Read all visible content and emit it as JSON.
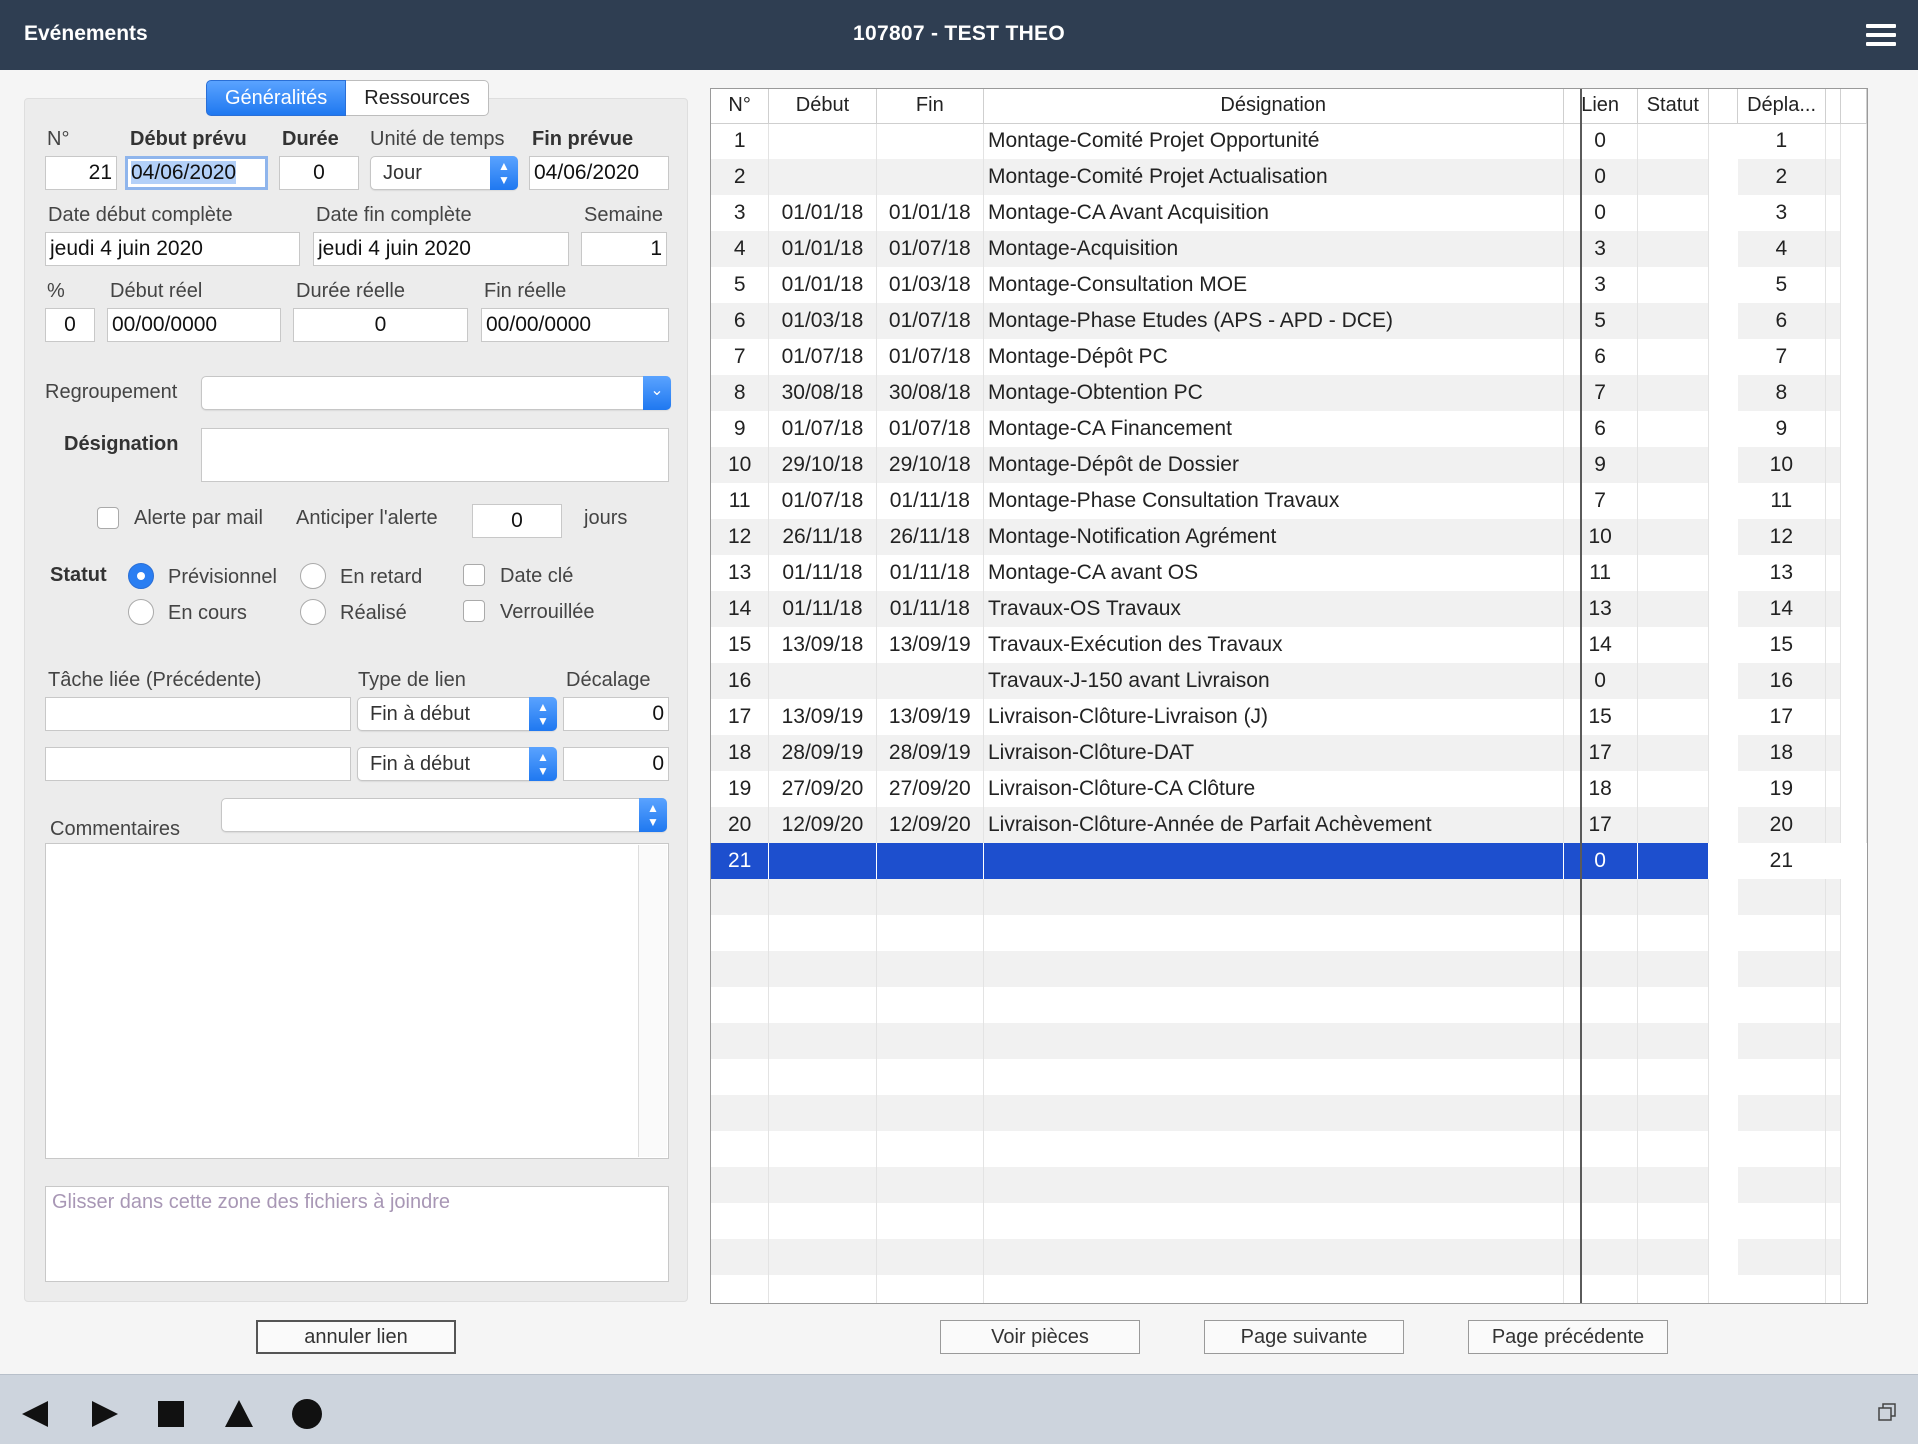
{
  "window": {
    "app_name": "Evénements",
    "title": "107807 - TEST THEO"
  },
  "tabs": [
    {
      "label": "Généralités",
      "active": true
    },
    {
      "label": "Ressources",
      "active": false
    }
  ],
  "form": {
    "no_label": "N°",
    "no_value": "21",
    "debut_prevu_label": "Début prévu",
    "debut_prevu_value": "04/06/2020",
    "duree_label": "Durée",
    "duree_value": "0",
    "unite_label": "Unité de temps",
    "unite_value": "Jour",
    "fin_prevue_label": "Fin prévue",
    "fin_prevue_value": "04/06/2020",
    "date_debut_complete_label": "Date début complète",
    "date_debut_complete_value": "jeudi 4 juin 2020",
    "date_fin_complete_label": "Date fin complète",
    "date_fin_complete_value": "jeudi 4 juin 2020",
    "semaine_label": "Semaine",
    "semaine_value": "1",
    "pct_label": "%",
    "pct_value": "0",
    "debut_reel_label": "Début réel",
    "debut_reel_value": "00/00/0000",
    "duree_reelle_label": "Durée réelle",
    "duree_reelle_value": "0",
    "fin_reelle_label": "Fin réelle",
    "fin_reelle_value": "00/00/0000",
    "regroupement_label": "Regroupement",
    "regroupement_value": "",
    "designation_label": "Désignation",
    "designation_value": "",
    "alerte_label": "Alerte par mail",
    "alerte_checked": false,
    "anticiper_label": "Anticiper l'alerte",
    "anticiper_value": "0",
    "jours_label": "jours",
    "statut_label": "Statut",
    "statut_options": {
      "previsionnel": "Prévisionnel",
      "en_retard": "En retard",
      "en_cours": "En cours",
      "realise": "Réalisé"
    },
    "statut_selected": "Prévisionnel",
    "date_cle_label": "Date clé",
    "verrouillee_label": "Verrouillée",
    "tache_liee_label": "Tâche liée (Précédente)",
    "type_lien_label": "Type de lien",
    "decalage_label": "Décalage",
    "links": [
      {
        "tache": "",
        "type": "Fin à début",
        "decalage": "0"
      },
      {
        "tache": "",
        "type": "Fin à début",
        "decalage": "0"
      }
    ],
    "commentaires_label": "Commentaires",
    "commentaires_value": "",
    "attach_placeholder": "Glisser dans cette zone des fichiers à joindre"
  },
  "buttons": {
    "annuler_lien": "annuler lien",
    "voir_pieces": "Voir pièces",
    "page_suivante": "Page suivante",
    "page_precedente": "Page précédente"
  },
  "table": {
    "headers": {
      "no": "N°",
      "debut": "Début",
      "fin": "Fin",
      "designation": "Désignation",
      "lien": "Lien",
      "statut": "Statut",
      "depla": "Dépla..."
    },
    "rows": [
      {
        "no": "1",
        "debut": "",
        "fin": "",
        "designation": "Montage-Comité Projet Opportunité",
        "lien": "0",
        "statut": "",
        "depla": "1"
      },
      {
        "no": "2",
        "debut": "",
        "fin": "",
        "designation": "Montage-Comité Projet Actualisation",
        "lien": "0",
        "statut": "",
        "depla": "2"
      },
      {
        "no": "3",
        "debut": "01/01/18",
        "fin": "01/01/18",
        "designation": "Montage-CA Avant Acquisition",
        "lien": "0",
        "statut": "",
        "depla": "3"
      },
      {
        "no": "4",
        "debut": "01/01/18",
        "fin": "01/07/18",
        "designation": "Montage-Acquisition",
        "lien": "3",
        "statut": "",
        "depla": "4"
      },
      {
        "no": "5",
        "debut": "01/01/18",
        "fin": "01/03/18",
        "designation": "Montage-Consultation MOE",
        "lien": "3",
        "statut": "",
        "depla": "5"
      },
      {
        "no": "6",
        "debut": "01/03/18",
        "fin": "01/07/18",
        "designation": "Montage-Phase Etudes (APS - APD - DCE)",
        "lien": "5",
        "statut": "",
        "depla": "6"
      },
      {
        "no": "7",
        "debut": "01/07/18",
        "fin": "01/07/18",
        "designation": "Montage-Dépôt PC",
        "lien": "6",
        "statut": "",
        "depla": "7"
      },
      {
        "no": "8",
        "debut": "30/08/18",
        "fin": "30/08/18",
        "designation": "Montage-Obtention PC",
        "lien": "7",
        "statut": "",
        "depla": "8"
      },
      {
        "no": "9",
        "debut": "01/07/18",
        "fin": "01/07/18",
        "designation": "Montage-CA Financement",
        "lien": "6",
        "statut": "",
        "depla": "9"
      },
      {
        "no": "10",
        "debut": "29/10/18",
        "fin": "29/10/18",
        "designation": "Montage-Dépôt de Dossier",
        "lien": "9",
        "statut": "",
        "depla": "10"
      },
      {
        "no": "11",
        "debut": "01/07/18",
        "fin": "01/11/18",
        "designation": "Montage-Phase Consultation Travaux",
        "lien": "7",
        "statut": "",
        "depla": "11"
      },
      {
        "no": "12",
        "debut": "26/11/18",
        "fin": "26/11/18",
        "designation": "Montage-Notification Agrément",
        "lien": "10",
        "statut": "",
        "depla": "12"
      },
      {
        "no": "13",
        "debut": "01/11/18",
        "fin": "01/11/18",
        "designation": "Montage-CA avant OS",
        "lien": "11",
        "statut": "",
        "depla": "13"
      },
      {
        "no": "14",
        "debut": "01/11/18",
        "fin": "01/11/18",
        "designation": "Travaux-OS Travaux",
        "lien": "13",
        "statut": "",
        "depla": "14"
      },
      {
        "no": "15",
        "debut": "13/09/18",
        "fin": "13/09/19",
        "designation": "Travaux-Exécution des Travaux",
        "lien": "14",
        "statut": "",
        "depla": "15"
      },
      {
        "no": "16",
        "debut": "",
        "fin": "",
        "designation": "Travaux-J-150 avant Livraison",
        "lien": "0",
        "statut": "",
        "depla": "16"
      },
      {
        "no": "17",
        "debut": "13/09/19",
        "fin": "13/09/19",
        "designation": "Livraison-Clôture-Livraison (J)",
        "lien": "15",
        "statut": "",
        "depla": "17"
      },
      {
        "no": "18",
        "debut": "28/09/19",
        "fin": "28/09/19",
        "designation": "Livraison-Clôture-DAT",
        "lien": "17",
        "statut": "",
        "depla": "18"
      },
      {
        "no": "19",
        "debut": "27/09/20",
        "fin": "27/09/20",
        "designation": "Livraison-Clôture-CA Clôture",
        "lien": "18",
        "statut": "",
        "depla": "19"
      },
      {
        "no": "20",
        "debut": "12/09/20",
        "fin": "12/09/20",
        "designation": "Livraison-Clôture-Année de Parfait Achèvement",
        "lien": "17",
        "statut": "",
        "depla": "20"
      },
      {
        "no": "21",
        "debut": "",
        "fin": "",
        "designation": "",
        "lien": "0",
        "statut": "",
        "depla": "21",
        "selected": true
      }
    ],
    "empty_rows": 12
  },
  "toolbar_icons": [
    "back-triangle-icon",
    "play-triangle-icon",
    "stop-square-icon",
    "up-triangle-icon",
    "record-circle-icon"
  ],
  "colors": {
    "titlebar": "#2f3e52",
    "accent": "#1f78f0",
    "selected_row": "#1d4fce",
    "bottombar": "#cdd4dd"
  }
}
